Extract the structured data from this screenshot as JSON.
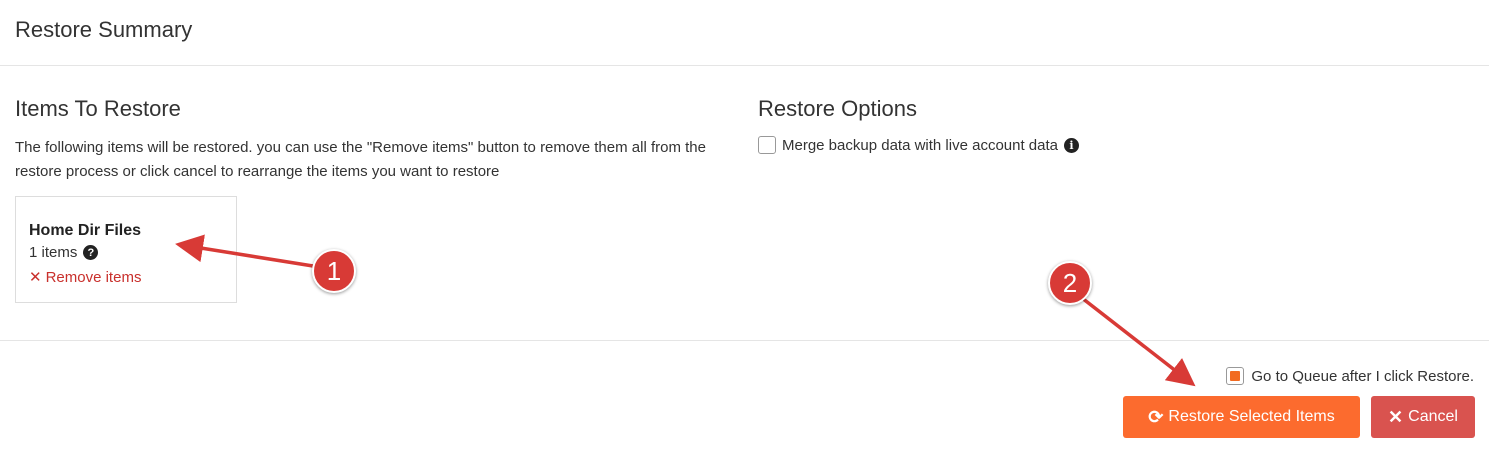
{
  "header": {
    "title": "Restore Summary"
  },
  "items_section": {
    "title": "Items To Restore",
    "description": "The following items will be restored. you can use the \"Remove items\" button to remove them all from the restore process or click cancel to rearrange the items you want to restore",
    "items": [
      {
        "name": "Home Dir Files",
        "count_label": "1 items",
        "remove_label": "Remove items"
      }
    ]
  },
  "options_section": {
    "title": "Restore Options",
    "merge_label": "Merge backup data with live account data",
    "merge_checked": false
  },
  "footer": {
    "queue_label": "Go to Queue after I click Restore.",
    "queue_checked": true,
    "restore_button_label": "Restore Selected Items",
    "cancel_button_label": "Cancel"
  },
  "annotations": {
    "marker_1": "1",
    "marker_2": "2"
  },
  "colors": {
    "accent": "#fc6b2e",
    "danger": "#d9534f",
    "marker": "#d83a36"
  },
  "icons": {
    "help": "question-circle-icon",
    "info": "info-circle-icon",
    "remove": "times-icon",
    "restore": "refresh-icon",
    "cancel": "times-icon"
  }
}
